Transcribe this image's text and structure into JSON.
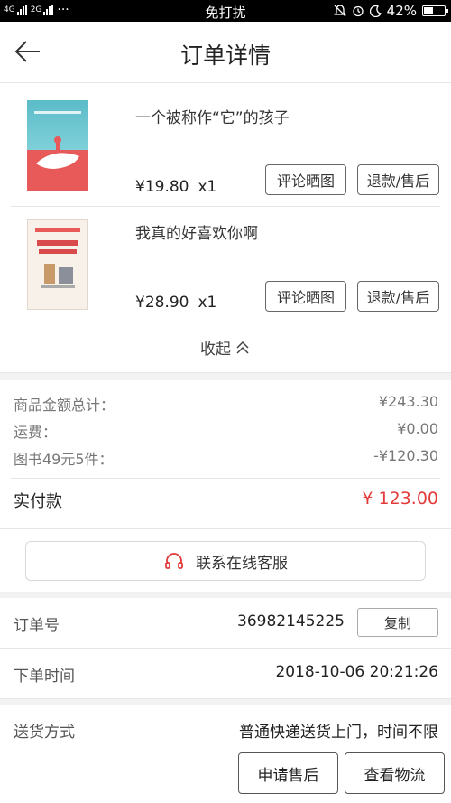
{
  "status_bar": {
    "network": "4G",
    "network2": "2G",
    "dots": "···",
    "center": "免打扰",
    "battery": "42%",
    "battery_level": 0.42
  },
  "header": {
    "title": "订单详情"
  },
  "products": [
    {
      "name": "一个被称作“它”的孩子",
      "price": "¥19.80",
      "qty": "x1",
      "review": "评论晒图",
      "refund": "退款/售后"
    },
    {
      "name": "我真的好喜欢你啊",
      "price": "¥28.90",
      "qty": "x1",
      "review": "评论晒图",
      "refund": "退款/售后"
    }
  ],
  "collapse": {
    "label": "收起"
  },
  "summary": {
    "rows": [
      {
        "label": "商品金额总计：",
        "value": "¥243.30"
      },
      {
        "label": "运费：",
        "value": "¥0.00"
      },
      {
        "label": "图书49元5件：",
        "value": "-¥120.30"
      }
    ],
    "paid_label": "实付款",
    "paid_value": "¥ 123.00",
    "accent_color": "#e23b3b"
  },
  "service": {
    "label": "联系在线客服"
  },
  "order": {
    "number_label": "订单号",
    "number": "36982145225",
    "copy": "复制",
    "time_label": "下单时间",
    "time": "2018-10-06 20:21:26",
    "delivery_label": "送货方式",
    "delivery": "普通快递送货上门，时间不限"
  },
  "actions": {
    "after_sale": "申请售后",
    "logistics": "查看物流"
  }
}
